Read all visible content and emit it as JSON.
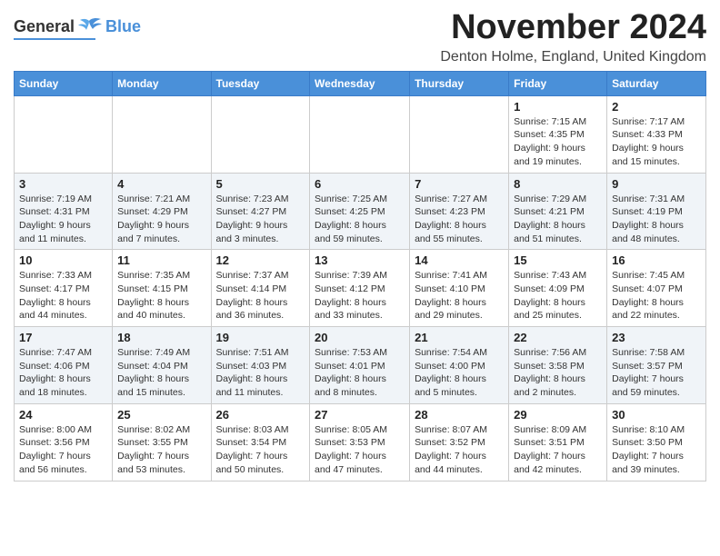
{
  "header": {
    "logo_general": "General",
    "logo_blue": "Blue",
    "month_title": "November 2024",
    "location": "Denton Holme, England, United Kingdom"
  },
  "days_of_week": [
    "Sunday",
    "Monday",
    "Tuesday",
    "Wednesday",
    "Thursday",
    "Friday",
    "Saturday"
  ],
  "weeks": [
    [
      {
        "day": "",
        "info": ""
      },
      {
        "day": "",
        "info": ""
      },
      {
        "day": "",
        "info": ""
      },
      {
        "day": "",
        "info": ""
      },
      {
        "day": "",
        "info": ""
      },
      {
        "day": "1",
        "info": "Sunrise: 7:15 AM\nSunset: 4:35 PM\nDaylight: 9 hours and 19 minutes."
      },
      {
        "day": "2",
        "info": "Sunrise: 7:17 AM\nSunset: 4:33 PM\nDaylight: 9 hours and 15 minutes."
      }
    ],
    [
      {
        "day": "3",
        "info": "Sunrise: 7:19 AM\nSunset: 4:31 PM\nDaylight: 9 hours and 11 minutes."
      },
      {
        "day": "4",
        "info": "Sunrise: 7:21 AM\nSunset: 4:29 PM\nDaylight: 9 hours and 7 minutes."
      },
      {
        "day": "5",
        "info": "Sunrise: 7:23 AM\nSunset: 4:27 PM\nDaylight: 9 hours and 3 minutes."
      },
      {
        "day": "6",
        "info": "Sunrise: 7:25 AM\nSunset: 4:25 PM\nDaylight: 8 hours and 59 minutes."
      },
      {
        "day": "7",
        "info": "Sunrise: 7:27 AM\nSunset: 4:23 PM\nDaylight: 8 hours and 55 minutes."
      },
      {
        "day": "8",
        "info": "Sunrise: 7:29 AM\nSunset: 4:21 PM\nDaylight: 8 hours and 51 minutes."
      },
      {
        "day": "9",
        "info": "Sunrise: 7:31 AM\nSunset: 4:19 PM\nDaylight: 8 hours and 48 minutes."
      }
    ],
    [
      {
        "day": "10",
        "info": "Sunrise: 7:33 AM\nSunset: 4:17 PM\nDaylight: 8 hours and 44 minutes."
      },
      {
        "day": "11",
        "info": "Sunrise: 7:35 AM\nSunset: 4:15 PM\nDaylight: 8 hours and 40 minutes."
      },
      {
        "day": "12",
        "info": "Sunrise: 7:37 AM\nSunset: 4:14 PM\nDaylight: 8 hours and 36 minutes."
      },
      {
        "day": "13",
        "info": "Sunrise: 7:39 AM\nSunset: 4:12 PM\nDaylight: 8 hours and 33 minutes."
      },
      {
        "day": "14",
        "info": "Sunrise: 7:41 AM\nSunset: 4:10 PM\nDaylight: 8 hours and 29 minutes."
      },
      {
        "day": "15",
        "info": "Sunrise: 7:43 AM\nSunset: 4:09 PM\nDaylight: 8 hours and 25 minutes."
      },
      {
        "day": "16",
        "info": "Sunrise: 7:45 AM\nSunset: 4:07 PM\nDaylight: 8 hours and 22 minutes."
      }
    ],
    [
      {
        "day": "17",
        "info": "Sunrise: 7:47 AM\nSunset: 4:06 PM\nDaylight: 8 hours and 18 minutes."
      },
      {
        "day": "18",
        "info": "Sunrise: 7:49 AM\nSunset: 4:04 PM\nDaylight: 8 hours and 15 minutes."
      },
      {
        "day": "19",
        "info": "Sunrise: 7:51 AM\nSunset: 4:03 PM\nDaylight: 8 hours and 11 minutes."
      },
      {
        "day": "20",
        "info": "Sunrise: 7:53 AM\nSunset: 4:01 PM\nDaylight: 8 hours and 8 minutes."
      },
      {
        "day": "21",
        "info": "Sunrise: 7:54 AM\nSunset: 4:00 PM\nDaylight: 8 hours and 5 minutes."
      },
      {
        "day": "22",
        "info": "Sunrise: 7:56 AM\nSunset: 3:58 PM\nDaylight: 8 hours and 2 minutes."
      },
      {
        "day": "23",
        "info": "Sunrise: 7:58 AM\nSunset: 3:57 PM\nDaylight: 7 hours and 59 minutes."
      }
    ],
    [
      {
        "day": "24",
        "info": "Sunrise: 8:00 AM\nSunset: 3:56 PM\nDaylight: 7 hours and 56 minutes."
      },
      {
        "day": "25",
        "info": "Sunrise: 8:02 AM\nSunset: 3:55 PM\nDaylight: 7 hours and 53 minutes."
      },
      {
        "day": "26",
        "info": "Sunrise: 8:03 AM\nSunset: 3:54 PM\nDaylight: 7 hours and 50 minutes."
      },
      {
        "day": "27",
        "info": "Sunrise: 8:05 AM\nSunset: 3:53 PM\nDaylight: 7 hours and 47 minutes."
      },
      {
        "day": "28",
        "info": "Sunrise: 8:07 AM\nSunset: 3:52 PM\nDaylight: 7 hours and 44 minutes."
      },
      {
        "day": "29",
        "info": "Sunrise: 8:09 AM\nSunset: 3:51 PM\nDaylight: 7 hours and 42 minutes."
      },
      {
        "day": "30",
        "info": "Sunrise: 8:10 AM\nSunset: 3:50 PM\nDaylight: 7 hours and 39 minutes."
      }
    ]
  ]
}
